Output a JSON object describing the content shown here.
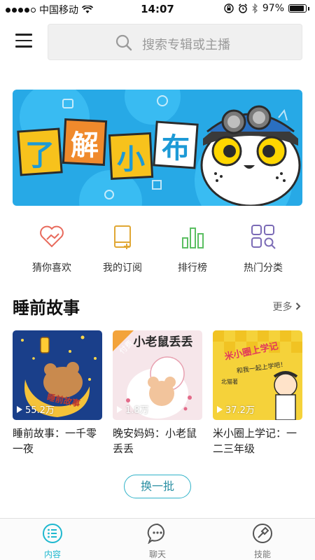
{
  "status_bar": {
    "carrier": "中国移动",
    "time": "14:07",
    "battery": "97%"
  },
  "search": {
    "placeholder": "搜索专辑或主播"
  },
  "banner": {
    "chars": [
      "了",
      "解",
      "小",
      "布"
    ]
  },
  "quick_nav": [
    {
      "label": "猜你喜欢",
      "icon": "heart-hand-icon"
    },
    {
      "label": "我的订阅",
      "icon": "book-add-icon"
    },
    {
      "label": "排行榜",
      "icon": "bar-chart-icon"
    },
    {
      "label": "热门分类",
      "icon": "grid-search-icon"
    }
  ],
  "section": {
    "title": "睡前故事",
    "more": "更多"
  },
  "cards": [
    {
      "title": "睡前故事：一千零一夜",
      "plays": "55.2万",
      "cover_text": "睡前故事"
    },
    {
      "title": "晚安妈妈：小老鼠丢丢",
      "plays": "1.8万",
      "cover_text": "小老鼠丢丢",
      "badge": "付费"
    },
    {
      "title": "米小圈上学记：一二三年级",
      "plays": "37.2万",
      "cover_text": "米小圈上学记",
      "cover_sub": "北猫著",
      "cover_tag": "和我一起上学吧！"
    }
  ],
  "refresh_label": "换一批",
  "tabs": [
    {
      "label": "内容",
      "icon": "list-icon",
      "active": true
    },
    {
      "label": "聊天",
      "icon": "chat-icon",
      "active": false
    },
    {
      "label": "技能",
      "icon": "skill-icon",
      "active": false
    }
  ],
  "colors": {
    "accent": "#1fb8cf",
    "banner_bg": "#27a9e6"
  }
}
